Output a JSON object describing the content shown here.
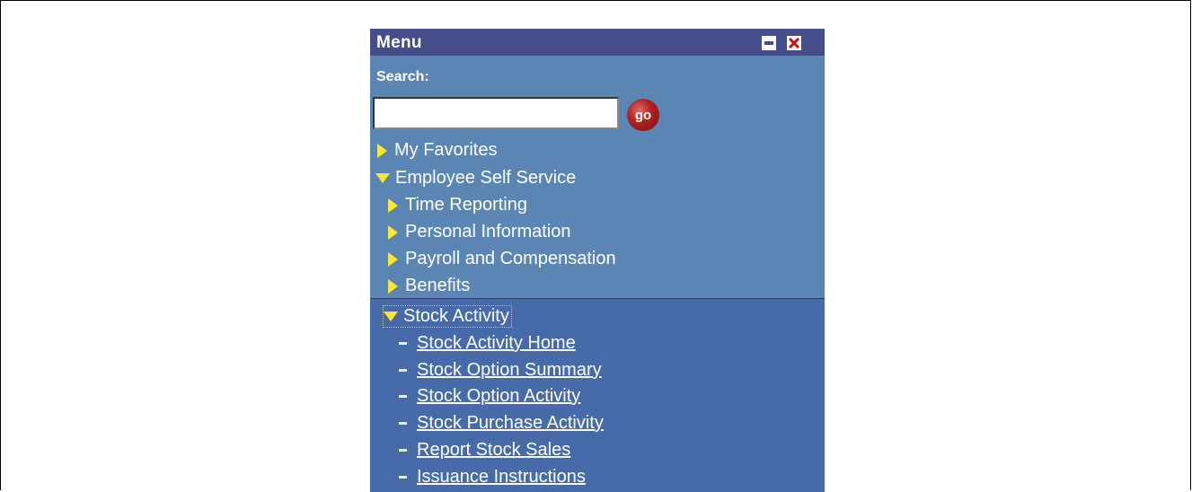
{
  "menu": {
    "title": "Menu",
    "search_label": "Search:",
    "search_value": "",
    "go_label": "go",
    "favorites": "My Favorites",
    "section": "Employee Self Service",
    "sub_items": [
      "Time Reporting",
      "Personal Information",
      "Payroll and Compensation",
      "Benefits"
    ],
    "stock": {
      "label": "Stock Activity",
      "links": [
        "Stock Activity Home",
        "Stock Option Summary",
        "Stock Option Activity",
        "Stock Purchase Activity",
        "Report Stock Sales",
        "Issuance Instructions"
      ]
    },
    "colors": {
      "titlebar": "#454e8a",
      "panel": "#5b86b4",
      "lower_panel": "#476aa8",
      "triangle": "#ffe633",
      "go_button": "#b42222"
    },
    "icons": [
      "minimize-icon",
      "close-icon",
      "collapsed-triangle-icon",
      "expanded-triangle-icon",
      "dash-bullet-icon"
    ]
  }
}
